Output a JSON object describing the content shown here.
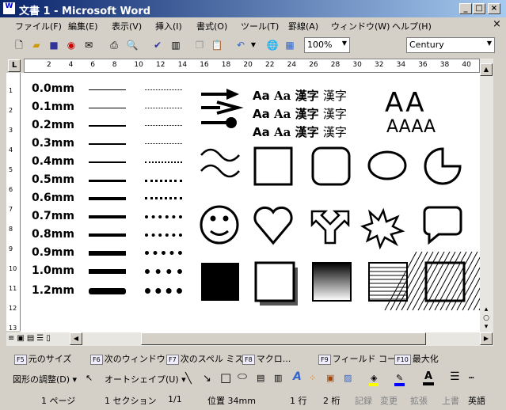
{
  "window": {
    "title": "文書 1 - Microsoft Word",
    "min": "_",
    "max": "□",
    "close": "×"
  },
  "menu": [
    "ファイル(F)",
    "編集(E)",
    "表示(V)",
    "挿入(I)",
    "書式(O)",
    "ツール(T)",
    "罫線(A)",
    "ウィンドウ(W)",
    "ヘルプ(H)"
  ],
  "menu_close": "×",
  "toolbar": {
    "zoom": "100%",
    "font": "Century"
  },
  "ruler": {
    "corner": "L",
    "ticks": [
      "2",
      "4",
      "6",
      "8",
      "10",
      "12",
      "14",
      "16",
      "18",
      "20",
      "22",
      "24",
      "26",
      "28",
      "30",
      "32",
      "34",
      "36",
      "38",
      "40"
    ]
  },
  "vruler": [
    "1",
    "2",
    "3",
    "4",
    "5",
    "6",
    "7",
    "8",
    "9",
    "10",
    "11",
    "12",
    "13"
  ],
  "document": {
    "line_widths": [
      "0.0mm",
      "0.1mm",
      "0.2mm",
      "0.3mm",
      "0.4mm",
      "0.5mm",
      "0.6mm",
      "0.7mm",
      "0.8mm",
      "0.9mm",
      "1.0mm",
      "1.2mm"
    ],
    "font_samples": [
      "Aa",
      "Aa",
      "漢字",
      "漢字"
    ],
    "big_a_top": "AA",
    "big_a_bottom": "AAAA"
  },
  "fkeys": [
    {
      "key": "F5",
      "label": "元のサイズ"
    },
    {
      "key": "F6",
      "label": "次のウィンドウ"
    },
    {
      "key": "F7",
      "label": "次のスペル ミス"
    },
    {
      "key": "F8",
      "label": "マクロ..."
    },
    {
      "key": "F9",
      "label": "フィールド コー.."
    },
    {
      "key": "F10",
      "label": "最大化"
    }
  ],
  "drawing": {
    "adjust": "図形の調整(D)",
    "autoshape": "オートシェイプ(U)",
    "fill_color": "#ffff00",
    "line_color": "#0000ff",
    "font_color": "#000000"
  },
  "status": {
    "page": "1 ページ",
    "section": "1 セクション",
    "pages": "1/1",
    "position": "位置 34mm",
    "line": "1 行",
    "column": "2 桁",
    "rec": "記録",
    "trk": "変更",
    "ext": "拡張",
    "ovr": "上書",
    "lang": "英語"
  }
}
